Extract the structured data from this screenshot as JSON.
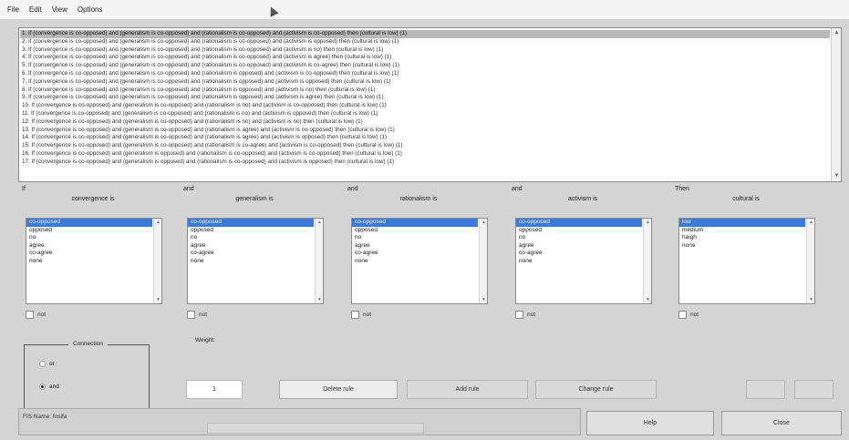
{
  "menu": [
    "File",
    "Edit",
    "View",
    "Options"
  ],
  "rules": [
    "1. If (convergence is co-opposed) and (generalism is co-opposed) and (rationalism is co-opposed) and (activism is co-opposed) then (cultural is low) (1)",
    "2. If (convergence is co-opposed) and (generalism is co-opposed) and (rationalism is co-opposed) and (activism is opposed) then (cultural is low) (1)",
    "3. If (convergence is co-opposed) and (generalism is co-opposed) and (rationalism is co-opposed) and (activism is no) then (cultural is low) (1)",
    "4. If (convergence is co-opposed) and (generalism is co-opposed) and (rationalism is co-opposed) and (activism is agree) then (cultural is low) (1)",
    "5. If (convergence is co-opposed) and (generalism is co-opposed) and (rationalism is co-opposed) and (activism is co-agree) then (cultural is low) (1)",
    "6. If (convergence is co-opposed) and (generalism is co-opposed) and (rationalism is opposed) and (activism is co-opposed) then (cultural is low) (1)",
    "7. If (convergence is co-opposed) and (generalism is co-opposed) and (rationalism is opposed) and (activism is opposed) then (cultural is low) (1)",
    "8. If (convergence is co-opposed) and (generalism is co-opposed) and (rationalism is opposed) and (activism is no) then (cultural is low) (1)",
    "9. If (convergence is co-opposed) and (generalism is co-opposed) and (rationalism is opposed) and (activism is agree) then (cultural is low) (1)",
    "10. If (convergence is co-opposed) and (generalism is co-opposed) and (rationalism is no) and (activism is co-opposed) then (cultural is low) (1)",
    "11. If (convergence is co-opposed) and (generalism is co-opposed) and (rationalism is no) and (activism is opposed) then (cultural is low) (1)",
    "12. If (convergence is co-opposed) and (generalism is co-opposed) and (rationalism is no) and (activism is no) then (cultural is low) (1)",
    "13. If (convergence is co-opposed) and (generalism is co-opposed) and (rationalism is agree) and (activism is co-opposed) then (cultural is low) (1)",
    "14. If (convergence is co-opposed) and (generalism is co-opposed) and (rationalism is agree) and (activism is opposed) then (cultural is low) (1)",
    "15. If (convergence is co-opposed) and (generalism is co-opposed) and (rationalism is co-agree) and (activism is co-opposed) then (cultural is low) (1)",
    "16. If (convergence is co-opposed) and (generalism is opposed) and (rationalism is co-opposed) and (activism is co-opposed) then (cultural is low) (1)",
    "17. If (convergence is co-opposed) and (generalism is opposed) and (rationalism is co-opposed) and (activism is opposed) then (cultural is low) (1)"
  ],
  "groups": [
    {
      "op": "If",
      "name": "convergence is",
      "options": [
        "co-opposed",
        "opposed",
        "no",
        "agree",
        "co-agree",
        "none"
      ],
      "not_label": "not"
    },
    {
      "op": "and",
      "name": "generalism is",
      "options": [
        "co-opposed",
        "opposed",
        "no",
        "agree",
        "co-agree",
        "none"
      ],
      "not_label": "not"
    },
    {
      "op": "and",
      "name": "rationalism is",
      "options": [
        "co-opposed",
        "opposed",
        "no",
        "agree",
        "co-agree",
        "none"
      ],
      "not_label": "not"
    },
    {
      "op": "and",
      "name": "activism is",
      "options": [
        "co-opposed",
        "opposed",
        "no",
        "agree",
        "co-agree",
        "none"
      ],
      "not_label": "not"
    },
    {
      "op": "Then",
      "name": "cultural is",
      "options": [
        "low",
        "medium",
        "haigh",
        "none"
      ],
      "not_label": "not"
    }
  ],
  "connection": {
    "title": "Connection",
    "or_label": "or",
    "and_label": "and"
  },
  "weight": {
    "label": "Weight:",
    "value": "1"
  },
  "buttons": {
    "delete": "Delete rule",
    "add": "Add rule",
    "change": "Change rule",
    "help": "Help",
    "close": "Close"
  },
  "status": {
    "text": "FIS Name: fnsifa"
  }
}
